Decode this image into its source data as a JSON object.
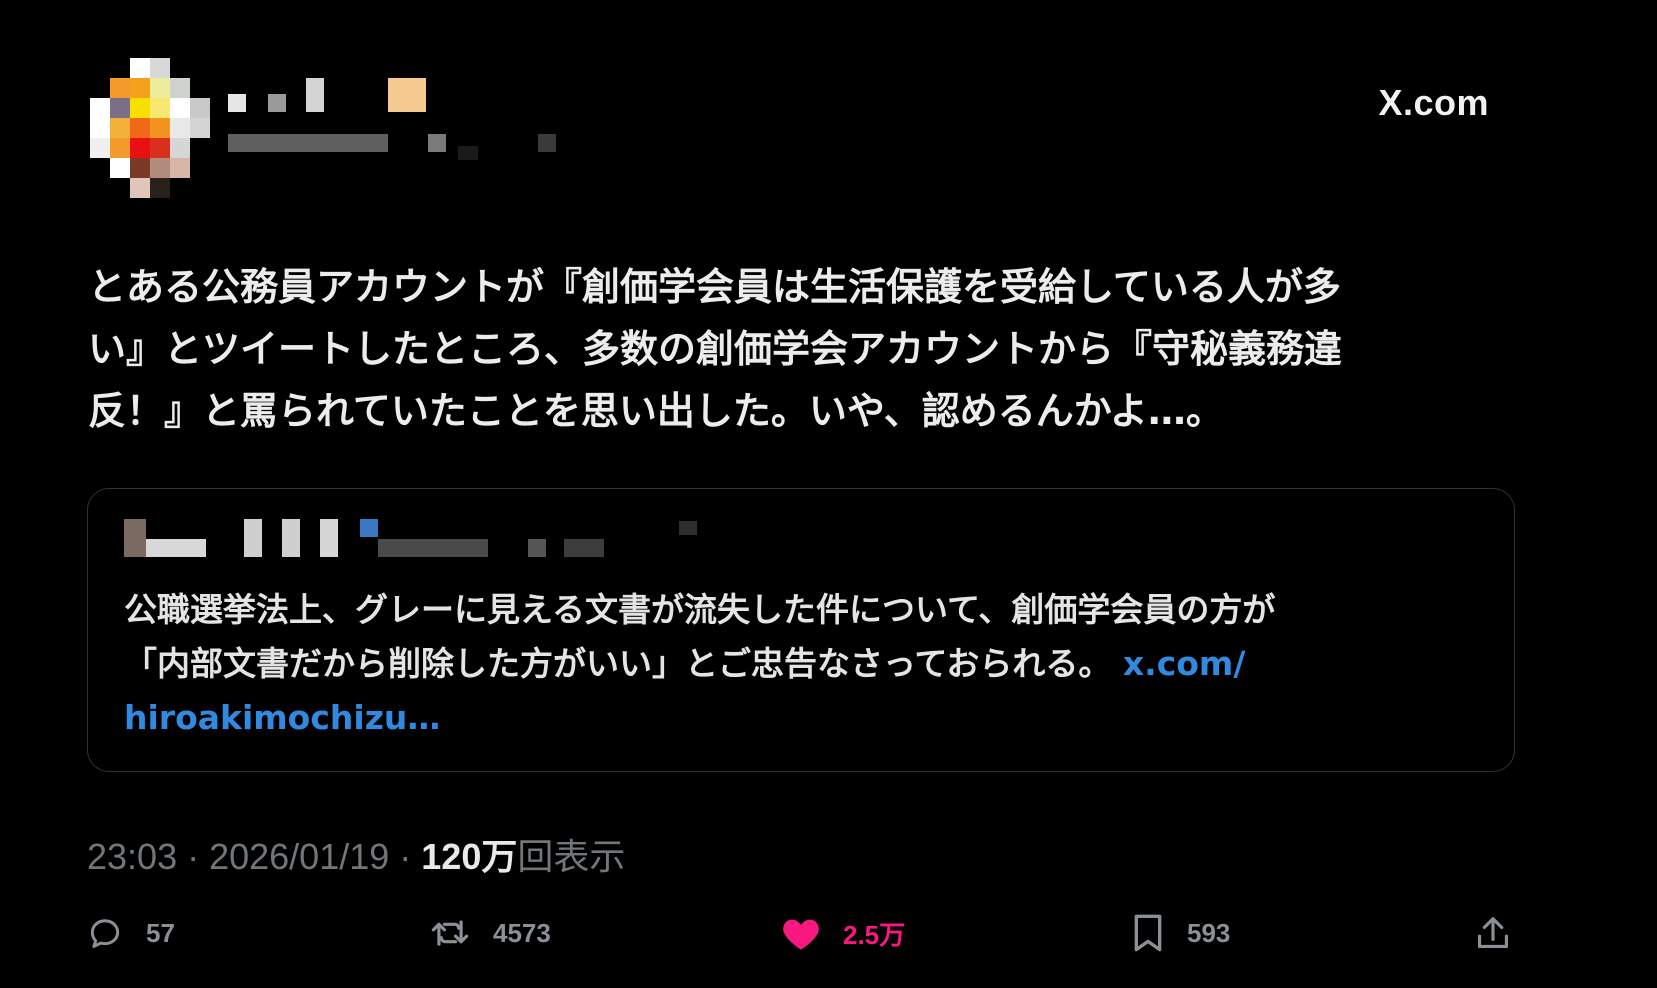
{
  "header": {
    "site_label": "X.com"
  },
  "tweet": {
    "text_lines": [
      "とある公務員アカウントが『創価学会員は生活保護を受給している人が多",
      "い』とツイートしたところ、多数の創価学会アカウントから『守秘義務違",
      "反！』と罵られていたことを思い出した。いや、認めるんかよ…。"
    ]
  },
  "quote": {
    "text_lines": [
      "公職選挙法上、グレーに見える文書が流失した件について、創価学会員の方が",
      "「内部文書だから削除した方がいい」とご忠告なさっておられる。"
    ],
    "link_part1": "x.com/",
    "link_part2": "hiroakimochizu…"
  },
  "meta": {
    "time": "23:03",
    "sep1": " · ",
    "date": "2026/01/19",
    "sep2": " · ",
    "views_number": "120万",
    "views_label": "回表示"
  },
  "actions": {
    "reply_count": "57",
    "retweet_count": "4573",
    "like_count": "2.5万",
    "bookmark_count": "593"
  },
  "colors": {
    "background": "#000000",
    "link": "#2f8ae0",
    "like": "#f91880",
    "muted": "#71767b"
  },
  "icons": [
    "reply-icon",
    "retweet-icon",
    "heart-icon",
    "bookmark-icon",
    "share-icon"
  ]
}
